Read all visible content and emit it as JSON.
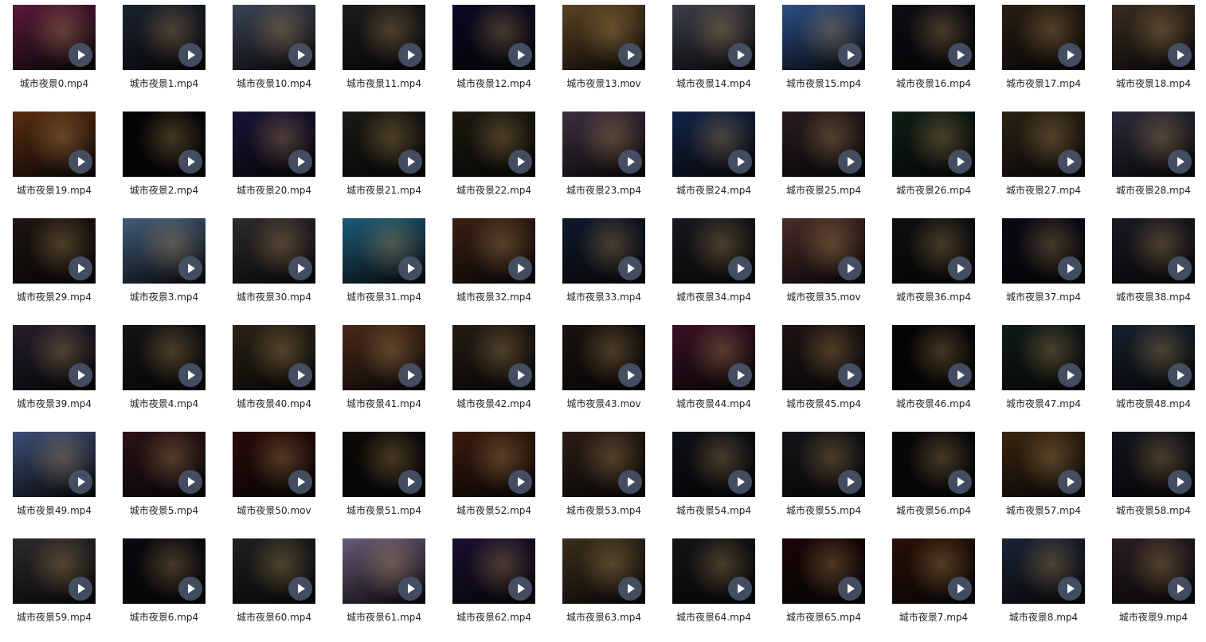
{
  "files": [
    {
      "name": "城市夜景0.mp4",
      "thumb": "#5a1a3a"
    },
    {
      "name": "城市夜景1.mp4",
      "thumb": "#1b2230"
    },
    {
      "name": "城市夜景10.mp4",
      "thumb": "#3c4456"
    },
    {
      "name": "城市夜景11.mp4",
      "thumb": "#1c1c1c"
    },
    {
      "name": "城市夜景12.mp4",
      "thumb": "#0a0a24"
    },
    {
      "name": "城市夜景13.mov",
      "thumb": "#5b4322"
    },
    {
      "name": "城市夜景14.mp4",
      "thumb": "#3c3f4c"
    },
    {
      "name": "城市夜景15.mp4",
      "thumb": "#2b4f87"
    },
    {
      "name": "城市夜景16.mp4",
      "thumb": "#0d0e14"
    },
    {
      "name": "城市夜景17.mp4",
      "thumb": "#2a1e12"
    },
    {
      "name": "城市夜景18.mp4",
      "thumb": "#3a2c21"
    },
    {
      "name": "城市夜景19.mp4",
      "thumb": "#5a2d10"
    },
    {
      "name": "城市夜景2.mp4",
      "thumb": "#050505"
    },
    {
      "name": "城市夜景20.mp4",
      "thumb": "#1a1436"
    },
    {
      "name": "城市夜景21.mp4",
      "thumb": "#1a1b14"
    },
    {
      "name": "城市夜景22.mp4",
      "thumb": "#1c1a10"
    },
    {
      "name": "城市夜景23.mp4",
      "thumb": "#3e3040"
    },
    {
      "name": "城市夜景24.mp4",
      "thumb": "#13254a"
    },
    {
      "name": "城市夜景25.mp4",
      "thumb": "#2a1c1f"
    },
    {
      "name": "城市夜景26.mp4",
      "thumb": "#0f1f16"
    },
    {
      "name": "城市夜景27.mp4",
      "thumb": "#2d2314"
    },
    {
      "name": "城市夜景28.mp4",
      "thumb": "#2c2b3c"
    },
    {
      "name": "城市夜景29.mp4",
      "thumb": "#1e1612"
    },
    {
      "name": "城市夜景3.mp4",
      "thumb": "#415c7a"
    },
    {
      "name": "城市夜景30.mp4",
      "thumb": "#2d2a2c"
    },
    {
      "name": "城市夜景31.mp4",
      "thumb": "#1c5c78"
    },
    {
      "name": "城市夜景32.mp4",
      "thumb": "#3a2014"
    },
    {
      "name": "城市夜景33.mp4",
      "thumb": "#0f1a2c"
    },
    {
      "name": "城市夜景34.mp4",
      "thumb": "#18191e"
    },
    {
      "name": "城市夜景35.mov",
      "thumb": "#4a2c28"
    },
    {
      "name": "城市夜景36.mp4",
      "thumb": "#0d0f10"
    },
    {
      "name": "城市夜景37.mp4",
      "thumb": "#0a0a16"
    },
    {
      "name": "城市夜景38.mp4",
      "thumb": "#1a1a24"
    },
    {
      "name": "城市夜景39.mp4",
      "thumb": "#241e2e"
    },
    {
      "name": "城市夜景4.mp4",
      "thumb": "#141414"
    },
    {
      "name": "城市夜景40.mp4",
      "thumb": "#2b2416"
    },
    {
      "name": "城市夜景41.mp4",
      "thumb": "#4a2a18"
    },
    {
      "name": "城市夜景42.mp4",
      "thumb": "#231c14"
    },
    {
      "name": "城市夜景43.mov",
      "thumb": "#1a130f"
    },
    {
      "name": "城市夜景44.mp4",
      "thumb": "#3a1024"
    },
    {
      "name": "城市夜景45.mp4",
      "thumb": "#1f1514"
    },
    {
      "name": "城市夜景46.mp4",
      "thumb": "#040404"
    },
    {
      "name": "城市夜景47.mp4",
      "thumb": "#0f1c1a"
    },
    {
      "name": "城市夜景48.mp4",
      "thumb": "#16222e"
    },
    {
      "name": "城市夜景49.mp4",
      "thumb": "#3b4f76"
    },
    {
      "name": "城市夜景5.mp4",
      "thumb": "#2c1216"
    },
    {
      "name": "城市夜景50.mov",
      "thumb": "#2a0a08"
    },
    {
      "name": "城市夜景51.mp4",
      "thumb": "#0d0a06"
    },
    {
      "name": "城市夜景52.mp4",
      "thumb": "#3c1a0d"
    },
    {
      "name": "城市夜景53.mp4",
      "thumb": "#2c1e16"
    },
    {
      "name": "城市夜景54.mp4",
      "thumb": "#0d1018"
    },
    {
      "name": "城市夜景55.mp4",
      "thumb": "#16161a"
    },
    {
      "name": "城市夜景56.mp4",
      "thumb": "#08080a"
    },
    {
      "name": "城市夜景57.mp4",
      "thumb": "#3a2510"
    },
    {
      "name": "城市夜景58.mp4",
      "thumb": "#13161e"
    },
    {
      "name": "城市夜景59.mp4",
      "thumb": "#2c2a2c"
    },
    {
      "name": "城市夜景6.mp4",
      "thumb": "#0a0a10"
    },
    {
      "name": "城市夜景60.mp4",
      "thumb": "#1e2220"
    },
    {
      "name": "城市夜景61.mp4",
      "thumb": "#6a5a78"
    },
    {
      "name": "城市夜景62.mp4",
      "thumb": "#1a1030"
    },
    {
      "name": "城市夜景63.mp4",
      "thumb": "#3a2e1c"
    },
    {
      "name": "城市夜景64.mp4",
      "thumb": "#121416"
    },
    {
      "name": "城市夜景65.mp4",
      "thumb": "#1a0606"
    },
    {
      "name": "城市夜景7.mp4",
      "thumb": "#2a1006"
    },
    {
      "name": "城市夜景8.mp4",
      "thumb": "#1a2436"
    },
    {
      "name": "城市夜景9.mp4",
      "thumb": "#2b1e22"
    }
  ]
}
